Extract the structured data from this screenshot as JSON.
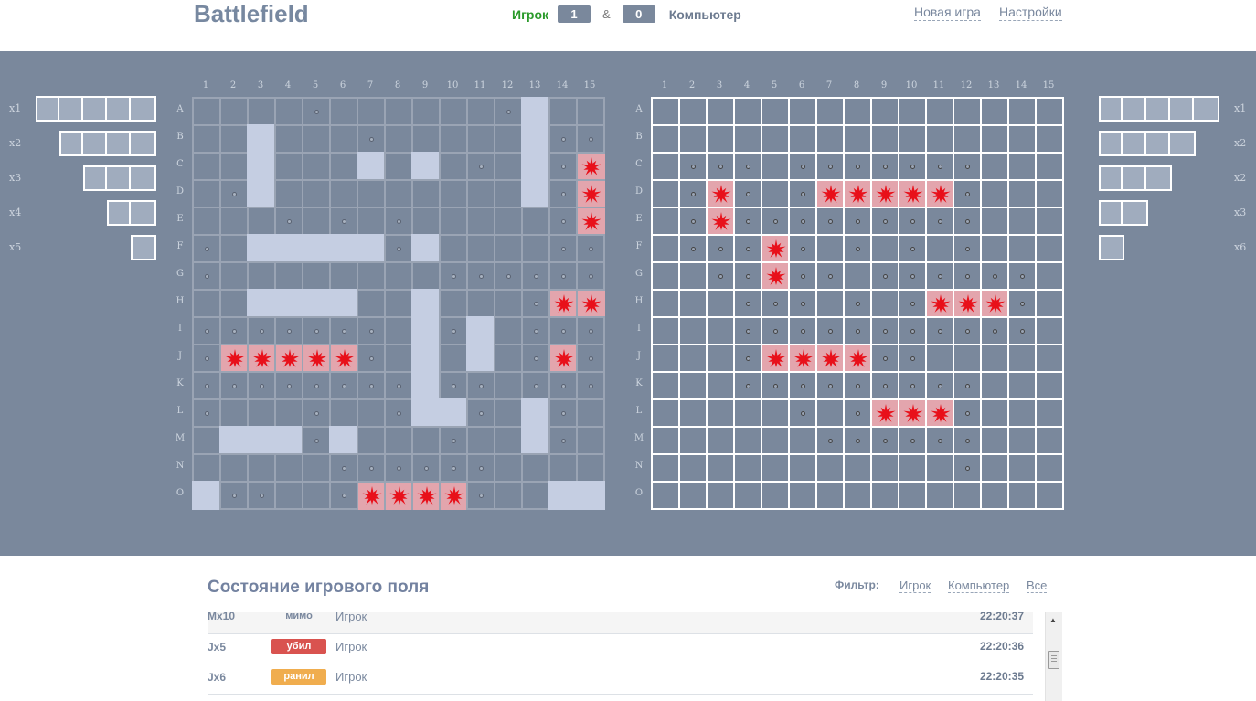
{
  "header": {
    "title": "Battlefield",
    "player_label": "Игрок",
    "player_score": "1",
    "amp": "&",
    "computer_score": "0",
    "computer_label": "Компьютер",
    "new_game": "Новая игра",
    "settings": "Настройки"
  },
  "columns": [
    "1",
    "2",
    "3",
    "4",
    "5",
    "6",
    "7",
    "8",
    "9",
    "10",
    "11",
    "12",
    "13",
    "14",
    "15"
  ],
  "rows": [
    "A",
    "B",
    "C",
    "D",
    "E",
    "F",
    "G",
    "H",
    "I",
    "J",
    "K",
    "L",
    "M",
    "N",
    "O"
  ],
  "legend": {
    "hit_icon": "explosion-icon",
    "miss_icon": "dot-icon"
  },
  "player_board": {
    "ships": [
      "A13",
      "B3",
      "B13",
      "C3",
      "C7",
      "C9",
      "C13",
      "D3",
      "D13",
      "F3",
      "F4",
      "F5",
      "F6",
      "F7",
      "F9",
      "H3",
      "H4",
      "H5",
      "H6",
      "H9",
      "I9",
      "I11",
      "J9",
      "J11",
      "K9",
      "L9",
      "L10",
      "L13",
      "M2",
      "M3",
      "M4",
      "M6",
      "M13",
      "O1",
      "O14",
      "O15"
    ],
    "misses": [
      "A5",
      "A12",
      "B7",
      "B14",
      "B15",
      "C11",
      "C14",
      "D2",
      "D14",
      "E4",
      "E6",
      "E8",
      "E14",
      "F1",
      "F8",
      "F14",
      "F15",
      "G1",
      "G10",
      "G11",
      "G12",
      "G13",
      "G14",
      "G15",
      "H13",
      "I1",
      "I2",
      "I3",
      "I4",
      "I5",
      "I6",
      "I7",
      "I10",
      "I13",
      "I14",
      "I15",
      "J1",
      "J7",
      "J13",
      "J15",
      "K1",
      "K2",
      "K3",
      "K4",
      "K5",
      "K6",
      "K7",
      "K8",
      "K10",
      "K11",
      "K13",
      "K14",
      "K15",
      "L1",
      "L5",
      "L8",
      "L11",
      "L14",
      "M5",
      "M10",
      "M14",
      "N6",
      "N7",
      "N8",
      "N9",
      "N10",
      "N11",
      "O2",
      "O3",
      "O6",
      "O11"
    ],
    "hits": [
      "C15",
      "D15",
      "E15",
      "H14",
      "H15",
      "J2",
      "J3",
      "J4",
      "J5",
      "J6",
      "J14",
      "O7",
      "O8",
      "O9",
      "O10"
    ]
  },
  "computer_board": {
    "misses": [
      "C2",
      "C3",
      "C4",
      "C6",
      "C7",
      "C8",
      "C9",
      "C10",
      "C11",
      "C12",
      "D2",
      "D4",
      "D6",
      "D12",
      "E2",
      "E4",
      "E5",
      "E6",
      "E7",
      "E8",
      "E9",
      "E10",
      "E11",
      "E12",
      "F2",
      "F3",
      "F4",
      "F6",
      "F8",
      "F10",
      "F12",
      "G3",
      "G4",
      "G6",
      "G7",
      "G9",
      "G10",
      "G11",
      "G12",
      "G13",
      "G14",
      "H4",
      "H5",
      "H6",
      "H8",
      "H10",
      "H14",
      "I4",
      "I5",
      "I6",
      "I7",
      "I8",
      "I9",
      "I10",
      "I11",
      "I12",
      "I13",
      "I14",
      "J4",
      "J9",
      "J10",
      "K4",
      "K5",
      "K6",
      "K7",
      "K8",
      "K9",
      "K10",
      "K11",
      "K12",
      "L6",
      "L8",
      "L12",
      "M7",
      "M8",
      "M9",
      "M10",
      "M11",
      "M12",
      "N12"
    ],
    "hits": [
      "D3",
      "D7",
      "D8",
      "D9",
      "D10",
      "D11",
      "E3",
      "F5",
      "G5",
      "H11",
      "H12",
      "H13",
      "J5",
      "J6",
      "J7",
      "J8",
      "L9",
      "L10",
      "L11"
    ]
  },
  "left_fleet": [
    {
      "label": "x1",
      "size": 5
    },
    {
      "label": "x2",
      "size": 4
    },
    {
      "label": "x3",
      "size": 3
    },
    {
      "label": "x4",
      "size": 2
    },
    {
      "label": "x5",
      "size": 1
    }
  ],
  "right_fleet": [
    {
      "label": "x1",
      "size": 5
    },
    {
      "label": "x2",
      "size": 4
    },
    {
      "label": "x2",
      "size": 3
    },
    {
      "label": "x3",
      "size": 2
    },
    {
      "label": "x6",
      "size": 1
    }
  ],
  "log": {
    "title": "Состояние игрового поля",
    "filter_label": "Фильтр:",
    "filters": [
      "Игрок",
      "Компьютер",
      "Все"
    ],
    "entries": [
      {
        "coord": "Mx10",
        "status": "мимо",
        "status_color": "",
        "who": "Игрок",
        "time": "22:20:37"
      },
      {
        "coord": "Jx5",
        "status": "убил",
        "status_color": "#d9534f",
        "who": "Игрок",
        "time": "22:20:36"
      },
      {
        "coord": "Jx6",
        "status": "ранил",
        "status_color": "#f0ad4e",
        "who": "Игрок",
        "time": "22:20:35"
      }
    ]
  }
}
